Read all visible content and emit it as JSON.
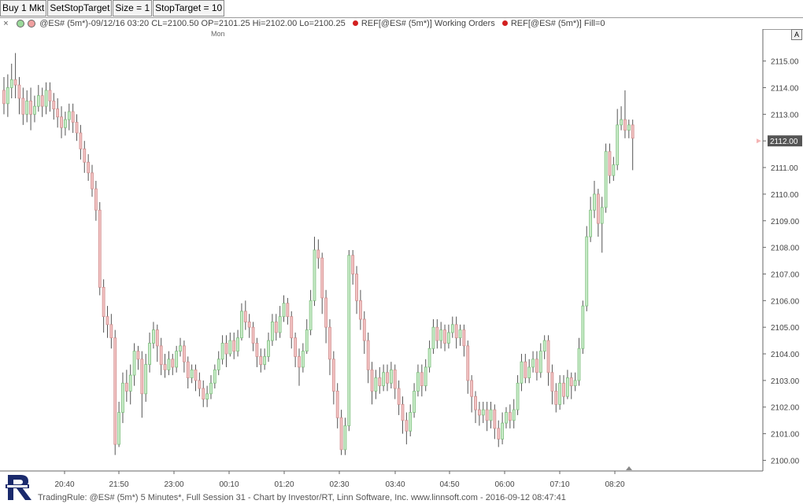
{
  "toolbar": {
    "buttons": [
      "Buy 1 Mkt",
      "SetStopTarget",
      "Size = 1",
      "StopTarget = 10"
    ]
  },
  "infobar": {
    "close_glyph": "×",
    "symbol_info": "@ES# (5m*)-09/12/16 03:20 CL=2100.50 OP=2101.25 Hi=2102.00 Lo=2100.25",
    "ref_working_orders": "REF[@ES# (5m*)] Working Orders",
    "ref_fill": "REF[@ES# (5m*)] Fill=0",
    "colors": {
      "dot1": "#9ad89a",
      "dot2": "#f0a0a0",
      "ref_dot": "#d22020"
    }
  },
  "auto_button": "A",
  "footer": "TradingRule: @ES# (5m*) 5 Minutes*, Full Session 31 - Chart by Investor/RT, Linn Software, Inc. www.linnsoft.com - 2016-09-12 08:47:41",
  "chart_data": {
    "type": "candlestick",
    "day_marker": "Mon",
    "last_price": "2112.00",
    "y_axis": {
      "min": 2099.6,
      "max": 2116.2,
      "ticks": [
        "2100.00",
        "2101.00",
        "2102.00",
        "2103.00",
        "2104.00",
        "2105.00",
        "2106.00",
        "2107.00",
        "2108.00",
        "2109.00",
        "2110.00",
        "2111.00",
        "2112.00",
        "2113.00",
        "2114.00",
        "2115.00"
      ]
    },
    "x_axis": {
      "ticks": [
        "20:40",
        "21:50",
        "23:00",
        "00:10",
        "01:20",
        "02:30",
        "03:40",
        "04:50",
        "06:00",
        "07:10",
        "08:20"
      ]
    },
    "colors": {
      "up_fill": "#c9ecc9",
      "up_edge": "#7fbf7f",
      "down_fill": "#f2c2c2",
      "down_edge": "#cf8f8f",
      "wick": "#555555",
      "grid": "#dddddd"
    },
    "candles": [
      [
        2113.9,
        2113.4,
        2114.4,
        2113.0
      ],
      [
        2113.4,
        2114.0,
        2114.5,
        2112.9
      ],
      [
        2114.0,
        2114.3,
        2114.9,
        2113.6
      ],
      [
        2114.3,
        2114.1,
        2115.3,
        2113.6
      ],
      [
        2114.1,
        2113.6,
        2114.4,
        2113.0
      ],
      [
        2113.6,
        2113.0,
        2114.0,
        2112.6
      ],
      [
        2113.0,
        2113.5,
        2113.9,
        2112.7
      ],
      [
        2113.5,
        2113.0,
        2114.0,
        2112.4
      ],
      [
        2113.0,
        2113.3,
        2113.7,
        2112.7
      ],
      [
        2113.3,
        2113.7,
        2114.1,
        2113.1
      ],
      [
        2113.7,
        2113.3,
        2114.0,
        2112.9
      ],
      [
        2113.3,
        2113.9,
        2114.2,
        2113.0
      ],
      [
        2113.9,
        2113.5,
        2114.2,
        2113.1
      ],
      [
        2113.5,
        2113.2,
        2113.8,
        2112.8
      ],
      [
        2113.2,
        2112.9,
        2113.6,
        2112.5
      ],
      [
        2112.9,
        2112.5,
        2113.3,
        2112.1
      ],
      [
        2112.5,
        2112.8,
        2113.1,
        2112.2
      ],
      [
        2112.8,
        2113.1,
        2113.4,
        2112.4
      ],
      [
        2113.1,
        2112.7,
        2113.4,
        2112.3
      ],
      [
        2112.7,
        2112.3,
        2113.0,
        2112.0
      ],
      [
        2112.3,
        2111.7,
        2112.6,
        2111.3
      ],
      [
        2111.7,
        2111.2,
        2112.0,
        2110.8
      ],
      [
        2111.2,
        2110.8,
        2111.5,
        2110.5
      ],
      [
        2110.8,
        2110.2,
        2111.1,
        2109.9
      ],
      [
        2110.2,
        2109.4,
        2110.5,
        2109.0
      ],
      [
        2109.4,
        2106.5,
        2109.7,
        2106.2
      ],
      [
        2106.5,
        2105.4,
        2106.8,
        2104.8
      ],
      [
        2105.4,
        2105.1,
        2105.8,
        2104.6
      ],
      [
        2105.1,
        2104.6,
        2105.5,
        2104.2
      ],
      [
        2104.6,
        2100.6,
        2104.9,
        2100.2
      ],
      [
        2100.6,
        2101.8,
        2102.2,
        2100.5
      ],
      [
        2101.8,
        2102.9,
        2103.3,
        2101.4
      ],
      [
        2102.9,
        2102.6,
        2103.4,
        2102.2
      ],
      [
        2102.6,
        2103.2,
        2103.6,
        2102.1
      ],
      [
        2103.2,
        2104.1,
        2104.4,
        2102.8
      ],
      [
        2104.1,
        2103.8,
        2104.3,
        2103.4
      ],
      [
        2103.8,
        2102.5,
        2104.1,
        2101.6
      ],
      [
        2102.5,
        2103.6,
        2104.0,
        2102.2
      ],
      [
        2103.6,
        2104.4,
        2104.8,
        2103.3
      ],
      [
        2104.4,
        2104.9,
        2105.2,
        2104.2
      ],
      [
        2104.9,
        2104.3,
        2105.1,
        2103.7
      ],
      [
        2104.3,
        2103.6,
        2104.6,
        2103.2
      ],
      [
        2103.6,
        2103.4,
        2104.0,
        2103.1
      ],
      [
        2103.4,
        2103.8,
        2104.1,
        2103.2
      ],
      [
        2103.8,
        2103.5,
        2104.0,
        2103.2
      ],
      [
        2103.5,
        2104.1,
        2104.3,
        2103.3
      ],
      [
        2104.1,
        2104.3,
        2104.6,
        2103.9
      ],
      [
        2104.3,
        2103.7,
        2104.5,
        2103.3
      ],
      [
        2103.7,
        2103.1,
        2103.9,
        2102.7
      ],
      [
        2103.1,
        2103.4,
        2103.6,
        2102.9
      ],
      [
        2103.4,
        2103.0,
        2103.6,
        2102.6
      ],
      [
        2103.0,
        2102.7,
        2103.3,
        2102.4
      ],
      [
        2102.7,
        2102.3,
        2103.0,
        2102.0
      ],
      [
        2102.3,
        2102.5,
        2102.8,
        2102.0
      ],
      [
        2102.5,
        2102.9,
        2103.2,
        2102.3
      ],
      [
        2102.9,
        2103.4,
        2103.6,
        2102.7
      ],
      [
        2103.4,
        2103.8,
        2104.1,
        2103.2
      ],
      [
        2103.8,
        2104.4,
        2104.7,
        2103.6
      ],
      [
        2104.4,
        2104.0,
        2104.7,
        2103.5
      ],
      [
        2104.0,
        2104.5,
        2104.8,
        2103.9
      ],
      [
        2104.5,
        2104.1,
        2104.8,
        2103.8
      ],
      [
        2104.1,
        2104.6,
        2104.9,
        2103.9
      ],
      [
        2104.6,
        2105.6,
        2105.9,
        2104.5
      ],
      [
        2105.6,
        2105.2,
        2106.0,
        2104.9
      ],
      [
        2105.2,
        2105.0,
        2105.5,
        2104.6
      ],
      [
        2105.0,
        2104.4,
        2105.2,
        2104.1
      ],
      [
        2104.4,
        2103.9,
        2104.6,
        2103.5
      ],
      [
        2103.9,
        2103.6,
        2104.2,
        2103.3
      ],
      [
        2103.6,
        2103.9,
        2104.2,
        2103.4
      ],
      [
        2103.9,
        2104.5,
        2104.8,
        2103.7
      ],
      [
        2104.5,
        2105.2,
        2105.5,
        2104.3
      ],
      [
        2105.2,
        2104.8,
        2105.5,
        2104.5
      ],
      [
        2104.8,
        2105.4,
        2105.8,
        2104.6
      ],
      [
        2105.4,
        2105.9,
        2106.2,
        2105.2
      ],
      [
        2105.9,
        2105.4,
        2106.1,
        2105.1
      ],
      [
        2105.4,
        2104.6,
        2105.6,
        2104.2
      ],
      [
        2104.6,
        2103.9,
        2104.8,
        2103.5
      ],
      [
        2103.9,
        2103.5,
        2104.2,
        2102.8
      ],
      [
        2103.5,
        2104.1,
        2104.4,
        2103.3
      ],
      [
        2104.1,
        2104.9,
        2105.3,
        2104.0
      ],
      [
        2104.9,
        2106.0,
        2106.4,
        2104.7
      ],
      [
        2106.0,
        2107.9,
        2108.4,
        2105.8
      ],
      [
        2107.9,
        2107.6,
        2108.3,
        2107.2
      ],
      [
        2107.6,
        2106.1,
        2107.8,
        2105.5
      ],
      [
        2106.1,
        2105.0,
        2106.4,
        2104.4
      ],
      [
        2105.0,
        2103.8,
        2105.3,
        2103.2
      ],
      [
        2103.8,
        2102.6,
        2104.1,
        2102.1
      ],
      [
        2102.6,
        2101.6,
        2102.9,
        2101.2
      ],
      [
        2101.6,
        2100.4,
        2101.9,
        2100.2
      ],
      [
        2100.4,
        2101.3,
        2101.6,
        2100.2
      ],
      [
        2101.3,
        2107.7,
        2107.9,
        2101.1
      ],
      [
        2107.7,
        2107.0,
        2107.9,
        2106.6
      ],
      [
        2107.0,
        2106.0,
        2107.3,
        2105.5
      ],
      [
        2106.0,
        2105.3,
        2106.4,
        2104.9
      ],
      [
        2105.3,
        2104.5,
        2105.6,
        2104.0
      ],
      [
        2104.5,
        2103.4,
        2104.8,
        2102.9
      ],
      [
        2103.4,
        2102.6,
        2103.7,
        2102.1
      ],
      [
        2102.6,
        2103.1,
        2103.4,
        2102.3
      ],
      [
        2103.1,
        2102.8,
        2103.5,
        2102.5
      ],
      [
        2102.8,
        2103.3,
        2103.6,
        2102.6
      ],
      [
        2103.3,
        2102.9,
        2103.6,
        2102.6
      ],
      [
        2102.9,
        2103.4,
        2103.7,
        2102.7
      ],
      [
        2103.4,
        2102.7,
        2103.6,
        2102.3
      ],
      [
        2102.7,
        2102.1,
        2103.0,
        2101.7
      ],
      [
        2102.1,
        2101.5,
        2102.4,
        2101.0
      ],
      [
        2101.5,
        2101.1,
        2101.8,
        2100.6
      ],
      [
        2101.1,
        2101.8,
        2102.1,
        2100.9
      ],
      [
        2101.8,
        2102.6,
        2102.9,
        2101.6
      ],
      [
        2102.6,
        2103.3,
        2103.6,
        2102.4
      ],
      [
        2103.3,
        2102.8,
        2103.6,
        2102.4
      ],
      [
        2102.8,
        2103.5,
        2103.8,
        2102.6
      ],
      [
        2103.5,
        2104.2,
        2104.5,
        2103.3
      ],
      [
        2104.2,
        2105.0,
        2105.3,
        2104.0
      ],
      [
        2105.0,
        2104.5,
        2105.3,
        2104.2
      ],
      [
        2104.5,
        2104.9,
        2105.2,
        2104.2
      ],
      [
        2104.9,
        2104.4,
        2105.1,
        2104.1
      ],
      [
        2104.4,
        2104.8,
        2105.1,
        2104.2
      ],
      [
        2104.8,
        2105.1,
        2105.4,
        2104.6
      ],
      [
        2105.1,
        2104.6,
        2105.4,
        2104.2
      ],
      [
        2104.6,
        2104.9,
        2105.1,
        2104.3
      ],
      [
        2104.9,
        2104.3,
        2105.1,
        2103.9
      ],
      [
        2104.3,
        2103.0,
        2104.5,
        2102.5
      ],
      [
        2103.0,
        2102.4,
        2103.2,
        2101.8
      ],
      [
        2102.4,
        2101.9,
        2102.6,
        2101.4
      ],
      [
        2101.9,
        2101.7,
        2102.2,
        2101.3
      ],
      [
        2101.7,
        2101.9,
        2102.2,
        2101.4
      ],
      [
        2101.9,
        2101.5,
        2102.2,
        2101.1
      ],
      [
        2101.5,
        2101.9,
        2102.2,
        2101.2
      ],
      [
        2101.9,
        2101.2,
        2102.1,
        2100.8
      ],
      [
        2101.2,
        2100.8,
        2101.5,
        2100.5
      ],
      [
        2100.8,
        2101.4,
        2101.8,
        2100.6
      ],
      [
        2101.4,
        2101.8,
        2102.0,
        2101.2
      ],
      [
        2101.8,
        2101.5,
        2102.1,
        2101.2
      ],
      [
        2101.5,
        2101.9,
        2102.3,
        2101.2
      ],
      [
        2101.9,
        2102.9,
        2103.2,
        2101.7
      ],
      [
        2102.9,
        2103.7,
        2104.0,
        2102.6
      ],
      [
        2103.7,
        2103.1,
        2104.0,
        2102.9
      ],
      [
        2103.1,
        2103.5,
        2103.8,
        2102.9
      ],
      [
        2103.5,
        2103.8,
        2104.1,
        2103.3
      ],
      [
        2103.8,
        2103.3,
        2104.1,
        2103.0
      ],
      [
        2103.3,
        2104.1,
        2104.4,
        2103.1
      ],
      [
        2104.1,
        2104.5,
        2104.7,
        2103.8
      ],
      [
        2104.5,
        2103.3,
        2104.7,
        2102.8
      ],
      [
        2103.3,
        2102.6,
        2103.6,
        2102.1
      ],
      [
        2102.6,
        2102.1,
        2102.9,
        2101.8
      ],
      [
        2102.1,
        2102.9,
        2103.2,
        2101.9
      ],
      [
        2102.9,
        2102.4,
        2103.2,
        2102.1
      ],
      [
        2102.4,
        2103.1,
        2103.4,
        2102.3
      ],
      [
        2103.1,
        2102.8,
        2103.3,
        2102.3
      ],
      [
        2102.8,
        2103.0,
        2103.3,
        2102.6
      ],
      [
        2103.0,
        2104.2,
        2104.6,
        2102.8
      ],
      [
        2104.2,
        2105.8,
        2106.0,
        2104.0
      ],
      [
        2105.8,
        2108.4,
        2108.8,
        2105.6
      ],
      [
        2108.4,
        2109.4,
        2109.9,
        2108.2
      ],
      [
        2109.4,
        2110.0,
        2110.5,
        2109.1
      ],
      [
        2110.0,
        2108.9,
        2110.2,
        2108.4
      ],
      [
        2108.9,
        2109.5,
        2109.9,
        2107.8
      ],
      [
        2109.5,
        2111.6,
        2111.9,
        2109.3
      ],
      [
        2111.6,
        2110.7,
        2111.9,
        2110.4
      ],
      [
        2110.7,
        2111.1,
        2111.4,
        2110.5
      ],
      [
        2111.1,
        2112.6,
        2113.2,
        2110.9
      ],
      [
        2112.6,
        2112.8,
        2113.3,
        2112.4
      ],
      [
        2112.8,
        2112.4,
        2113.9,
        2112.1
      ],
      [
        2112.4,
        2112.6,
        2112.8,
        2112.1
      ],
      [
        2112.6,
        2112.1,
        2112.8,
        2110.9
      ]
    ]
  }
}
